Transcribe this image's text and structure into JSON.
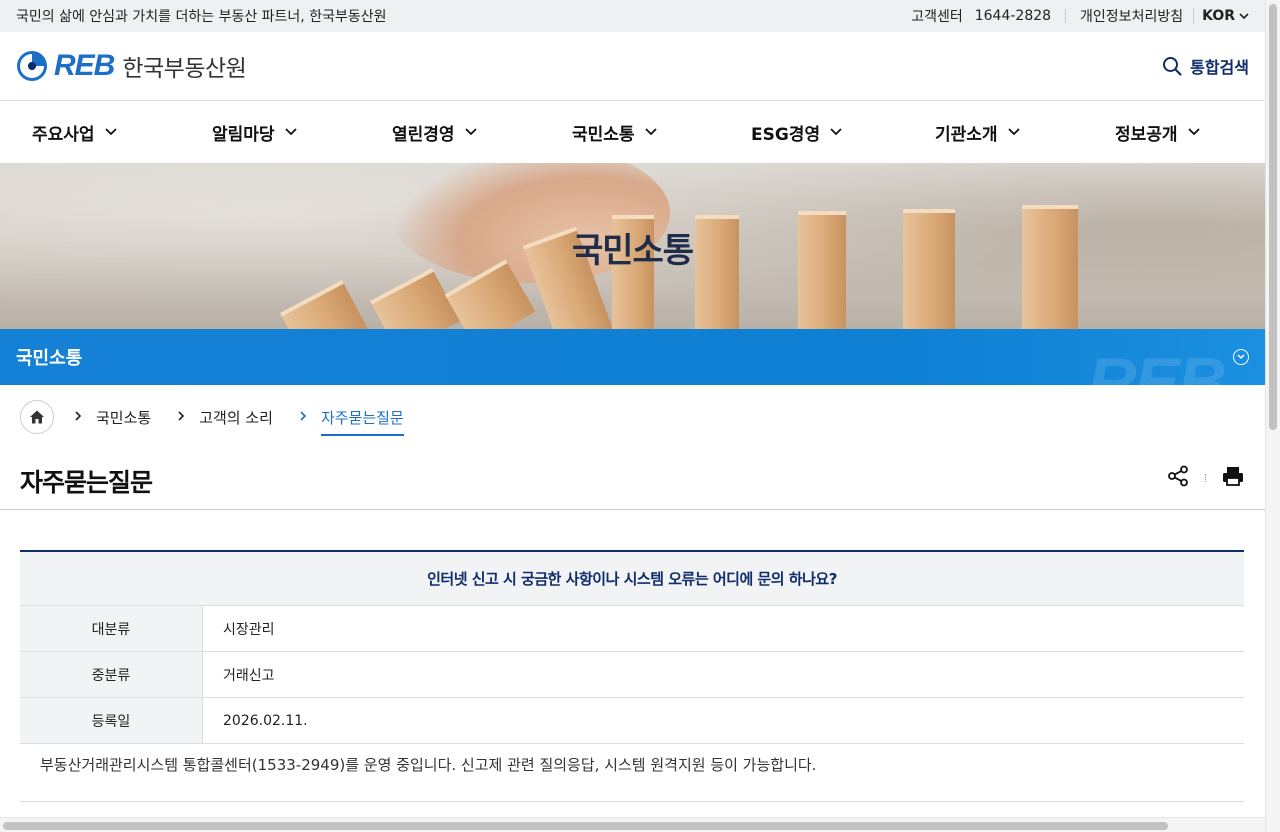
{
  "topbar": {
    "slogan": "국민의 삶에 안심과 가치를 더하는 부동산 파트너, 한국부동산원",
    "cs_label": "고객센터",
    "cs_phone": "1644-2828",
    "privacy": "개인정보처리방침",
    "language": "KOR"
  },
  "header": {
    "logo_mark": "REB",
    "logo_name": "한국부동산원",
    "search_label": "통합검색"
  },
  "gnb": {
    "items": [
      {
        "label": "주요사업"
      },
      {
        "label": "알림마당"
      },
      {
        "label": "열린경영"
      },
      {
        "label": "국민소통"
      },
      {
        "label": "ESG경영"
      },
      {
        "label": "기관소개"
      },
      {
        "label": "정보공개"
      }
    ]
  },
  "hero": {
    "title": "국민소통"
  },
  "section": {
    "label": "국민소통",
    "watermark": "REB"
  },
  "breadcrumb": {
    "items": [
      "국민소통",
      "고객의 소리"
    ],
    "current": "자주묻는질문"
  },
  "page": {
    "title": "자주묻는질문"
  },
  "faq": {
    "question": "인터넷 신고 시 궁금한 사항이나 시스템 오류는 어디에 문의 하나요?",
    "rows": [
      {
        "label": "대분류",
        "value": "시장관리"
      },
      {
        "label": "중분류",
        "value": "거래신고"
      },
      {
        "label": "등록일",
        "value": "2026.02.11."
      }
    ],
    "answer": "부동산거래관리시스템 통합콜센터(1533-2949)를 운영 중입니다. 신고제 관련 질의응답, 시스템 원격지원 등이 가능합니다."
  },
  "colors": {
    "brand_blue": "#1c6fc7",
    "navy": "#0f2d6b",
    "section_blue": "#0e7fd3"
  }
}
